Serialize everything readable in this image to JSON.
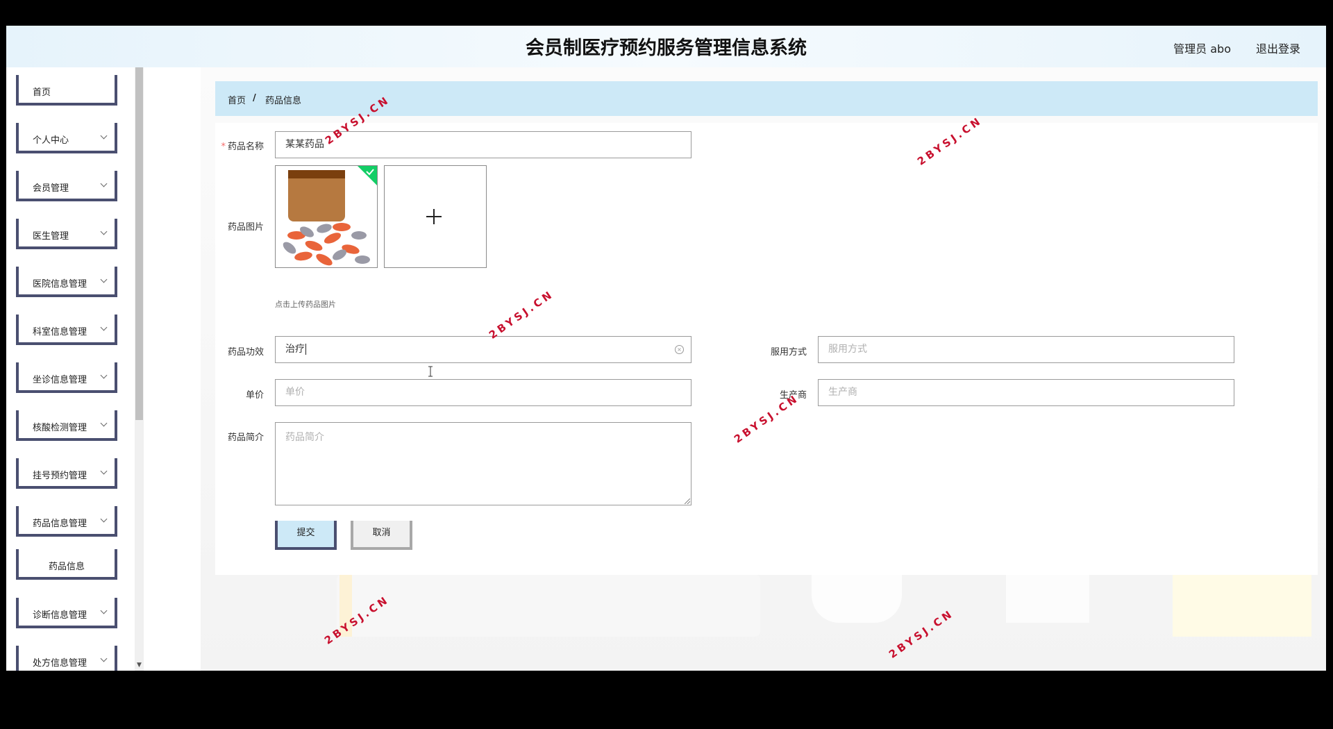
{
  "header": {
    "title": "会员制医疗预约服务管理信息系统",
    "user": "管理员 abo",
    "logout": "退出登录"
  },
  "sidebar": {
    "items": [
      {
        "label": "首页",
        "has_arrow": false
      },
      {
        "label": "个人中心",
        "has_arrow": true
      },
      {
        "label": "会员管理",
        "has_arrow": true
      },
      {
        "label": "医生管理",
        "has_arrow": true
      },
      {
        "label": "医院信息管理",
        "has_arrow": true
      },
      {
        "label": "科室信息管理",
        "has_arrow": true
      },
      {
        "label": "坐诊信息管理",
        "has_arrow": true
      },
      {
        "label": "核酸检测管理",
        "has_arrow": true
      },
      {
        "label": "挂号预约管理",
        "has_arrow": true
      },
      {
        "label": "药品信息管理",
        "has_arrow": true
      },
      {
        "label": "药品信息",
        "has_arrow": false
      },
      {
        "label": "诊断信息管理",
        "has_arrow": true
      },
      {
        "label": "处方信息管理",
        "has_arrow": true
      }
    ]
  },
  "breadcrumb": {
    "home": "首页",
    "separator": "/",
    "current": "药品信息"
  },
  "form": {
    "name_label": "药品名称",
    "name_value": "某某药品",
    "image_label": "药品图片",
    "image_tip": "点击上传药品图片",
    "effect_label": "药品功效",
    "effect_value": "治疗",
    "usage_label": "服用方式",
    "usage_placeholder": "服用方式",
    "price_label": "单价",
    "price_placeholder": "单价",
    "maker_label": "生产商",
    "maker_placeholder": "生产商",
    "intro_label": "药品简介",
    "intro_placeholder": "药品简介",
    "submit": "提交",
    "cancel": "取消"
  },
  "watermark": "2BYSJ.CN",
  "colors": {
    "accent_border": "#4a4f70",
    "breadcrumb_bg": "#cde9f7",
    "required": "#f56c6c",
    "watermark": "#c8102e",
    "success": "#13ce66"
  }
}
